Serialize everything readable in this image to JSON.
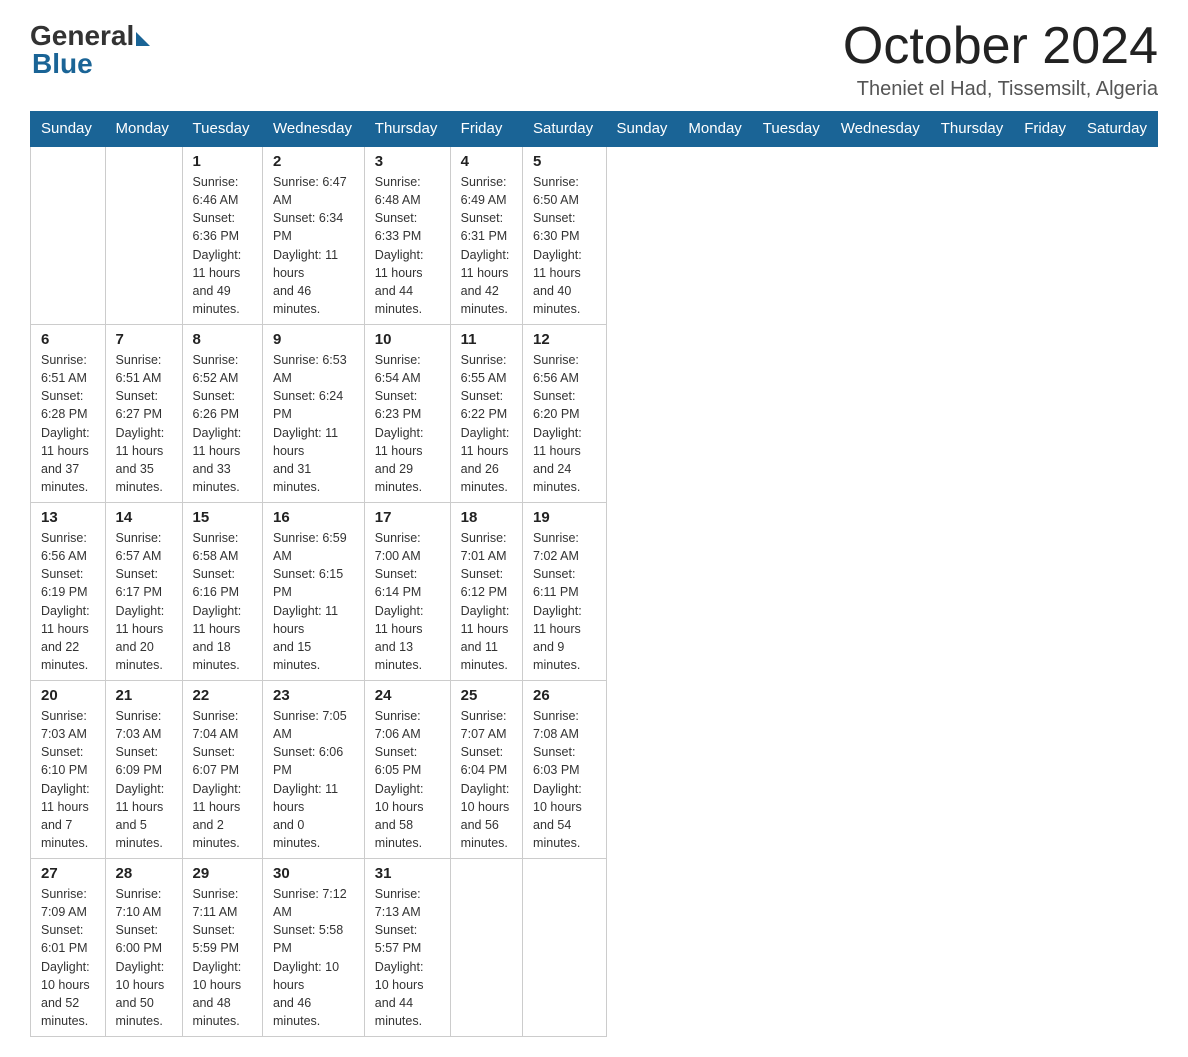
{
  "header": {
    "logo_general": "General",
    "logo_blue": "Blue",
    "month_title": "October 2024",
    "location": "Theniet el Had, Tissemsilt, Algeria"
  },
  "columns": [
    "Sunday",
    "Monday",
    "Tuesday",
    "Wednesday",
    "Thursday",
    "Friday",
    "Saturday"
  ],
  "weeks": [
    [
      {
        "day": "",
        "info": ""
      },
      {
        "day": "",
        "info": ""
      },
      {
        "day": "1",
        "info": "Sunrise: 6:46 AM\nSunset: 6:36 PM\nDaylight: 11 hours\nand 49 minutes."
      },
      {
        "day": "2",
        "info": "Sunrise: 6:47 AM\nSunset: 6:34 PM\nDaylight: 11 hours\nand 46 minutes."
      },
      {
        "day": "3",
        "info": "Sunrise: 6:48 AM\nSunset: 6:33 PM\nDaylight: 11 hours\nand 44 minutes."
      },
      {
        "day": "4",
        "info": "Sunrise: 6:49 AM\nSunset: 6:31 PM\nDaylight: 11 hours\nand 42 minutes."
      },
      {
        "day": "5",
        "info": "Sunrise: 6:50 AM\nSunset: 6:30 PM\nDaylight: 11 hours\nand 40 minutes."
      }
    ],
    [
      {
        "day": "6",
        "info": "Sunrise: 6:51 AM\nSunset: 6:28 PM\nDaylight: 11 hours\nand 37 minutes."
      },
      {
        "day": "7",
        "info": "Sunrise: 6:51 AM\nSunset: 6:27 PM\nDaylight: 11 hours\nand 35 minutes."
      },
      {
        "day": "8",
        "info": "Sunrise: 6:52 AM\nSunset: 6:26 PM\nDaylight: 11 hours\nand 33 minutes."
      },
      {
        "day": "9",
        "info": "Sunrise: 6:53 AM\nSunset: 6:24 PM\nDaylight: 11 hours\nand 31 minutes."
      },
      {
        "day": "10",
        "info": "Sunrise: 6:54 AM\nSunset: 6:23 PM\nDaylight: 11 hours\nand 29 minutes."
      },
      {
        "day": "11",
        "info": "Sunrise: 6:55 AM\nSunset: 6:22 PM\nDaylight: 11 hours\nand 26 minutes."
      },
      {
        "day": "12",
        "info": "Sunrise: 6:56 AM\nSunset: 6:20 PM\nDaylight: 11 hours\nand 24 minutes."
      }
    ],
    [
      {
        "day": "13",
        "info": "Sunrise: 6:56 AM\nSunset: 6:19 PM\nDaylight: 11 hours\nand 22 minutes."
      },
      {
        "day": "14",
        "info": "Sunrise: 6:57 AM\nSunset: 6:17 PM\nDaylight: 11 hours\nand 20 minutes."
      },
      {
        "day": "15",
        "info": "Sunrise: 6:58 AM\nSunset: 6:16 PM\nDaylight: 11 hours\nand 18 minutes."
      },
      {
        "day": "16",
        "info": "Sunrise: 6:59 AM\nSunset: 6:15 PM\nDaylight: 11 hours\nand 15 minutes."
      },
      {
        "day": "17",
        "info": "Sunrise: 7:00 AM\nSunset: 6:14 PM\nDaylight: 11 hours\nand 13 minutes."
      },
      {
        "day": "18",
        "info": "Sunrise: 7:01 AM\nSunset: 6:12 PM\nDaylight: 11 hours\nand 11 minutes."
      },
      {
        "day": "19",
        "info": "Sunrise: 7:02 AM\nSunset: 6:11 PM\nDaylight: 11 hours\nand 9 minutes."
      }
    ],
    [
      {
        "day": "20",
        "info": "Sunrise: 7:03 AM\nSunset: 6:10 PM\nDaylight: 11 hours\nand 7 minutes."
      },
      {
        "day": "21",
        "info": "Sunrise: 7:03 AM\nSunset: 6:09 PM\nDaylight: 11 hours\nand 5 minutes."
      },
      {
        "day": "22",
        "info": "Sunrise: 7:04 AM\nSunset: 6:07 PM\nDaylight: 11 hours\nand 2 minutes."
      },
      {
        "day": "23",
        "info": "Sunrise: 7:05 AM\nSunset: 6:06 PM\nDaylight: 11 hours\nand 0 minutes."
      },
      {
        "day": "24",
        "info": "Sunrise: 7:06 AM\nSunset: 6:05 PM\nDaylight: 10 hours\nand 58 minutes."
      },
      {
        "day": "25",
        "info": "Sunrise: 7:07 AM\nSunset: 6:04 PM\nDaylight: 10 hours\nand 56 minutes."
      },
      {
        "day": "26",
        "info": "Sunrise: 7:08 AM\nSunset: 6:03 PM\nDaylight: 10 hours\nand 54 minutes."
      }
    ],
    [
      {
        "day": "27",
        "info": "Sunrise: 7:09 AM\nSunset: 6:01 PM\nDaylight: 10 hours\nand 52 minutes."
      },
      {
        "day": "28",
        "info": "Sunrise: 7:10 AM\nSunset: 6:00 PM\nDaylight: 10 hours\nand 50 minutes."
      },
      {
        "day": "29",
        "info": "Sunrise: 7:11 AM\nSunset: 5:59 PM\nDaylight: 10 hours\nand 48 minutes."
      },
      {
        "day": "30",
        "info": "Sunrise: 7:12 AM\nSunset: 5:58 PM\nDaylight: 10 hours\nand 46 minutes."
      },
      {
        "day": "31",
        "info": "Sunrise: 7:13 AM\nSunset: 5:57 PM\nDaylight: 10 hours\nand 44 minutes."
      },
      {
        "day": "",
        "info": ""
      },
      {
        "day": "",
        "info": ""
      }
    ]
  ]
}
